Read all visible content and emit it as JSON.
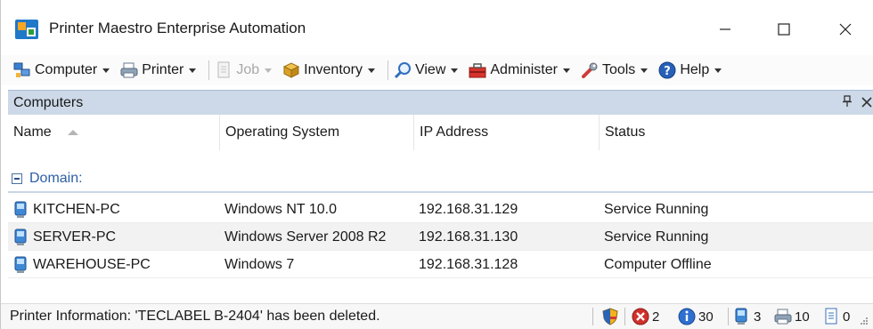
{
  "window": {
    "title": "Printer Maestro Enterprise Automation",
    "minimize_glyph": "—",
    "maximize_glyph": "☐",
    "close_glyph": "✕"
  },
  "toolbar": {
    "items": [
      {
        "label": "Computer",
        "icon": "computer-network-icon",
        "enabled": true
      },
      {
        "label": "Printer",
        "icon": "printer-icon",
        "enabled": true
      },
      {
        "label": "Job",
        "icon": "document-icon",
        "enabled": false
      },
      {
        "label": "Inventory",
        "icon": "box-icon",
        "enabled": true
      },
      {
        "label": "View",
        "icon": "magnifier-icon",
        "enabled": true
      },
      {
        "label": "Administer",
        "icon": "toolbox-icon",
        "enabled": true
      },
      {
        "label": "Tools",
        "icon": "wrench-icon",
        "enabled": true
      },
      {
        "label": "Help",
        "icon": "help-icon",
        "enabled": true
      }
    ]
  },
  "panel": {
    "title": "Computers",
    "pin_glyph": "ᵩ",
    "close_glyph": "✕"
  },
  "grid": {
    "columns": [
      "Name",
      "Operating System",
      "IP Address",
      "Status"
    ],
    "sorted_column": "Name",
    "sort_direction": "ascending",
    "group_label": "Domain:",
    "rows": [
      {
        "name": "KITCHEN-PC",
        "os": "Windows NT 10.0",
        "ip": "192.168.31.129",
        "status": "Service Running"
      },
      {
        "name": "SERVER-PC",
        "os": "Windows Server 2008 R2",
        "ip": "192.168.31.130",
        "status": "Service Running"
      },
      {
        "name": "WAREHOUSE-PC",
        "os": "Windows 7",
        "ip": "192.168.31.128",
        "status": "Computer Offline"
      }
    ]
  },
  "statusbar": {
    "message": "Printer Information: 'TECLABEL B-2404' has been deleted.",
    "counters": {
      "errors": "2",
      "info": "30",
      "computers": "3",
      "printers": "10",
      "jobs": "0"
    }
  },
  "colors": {
    "panel_header": "#cdd9e8",
    "group_text": "#2d5ea8",
    "alt_row": "#f2f2f2"
  }
}
